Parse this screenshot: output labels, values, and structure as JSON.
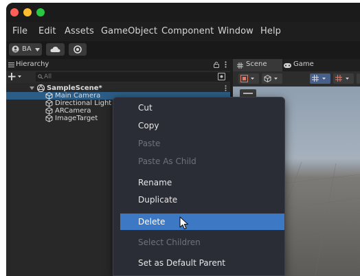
{
  "menubar": {
    "items": [
      "File",
      "Edit",
      "Assets",
      "GameObject",
      "Component",
      "Window",
      "Help"
    ]
  },
  "toolbar": {
    "account_label": "BA"
  },
  "hierarchy": {
    "title": "Hierarchy",
    "search_placeholder": "All",
    "scene_name": "SampleScene*",
    "objects": [
      "Main Camera",
      "Directional Light",
      "ARCamera",
      "ImageTarget"
    ],
    "selected_object": "Main Camera"
  },
  "scene_panel": {
    "tabs": [
      "Scene",
      "Game"
    ],
    "active_tab": "Scene"
  },
  "context_menu": {
    "items": [
      {
        "label": "Cut",
        "enabled": true
      },
      {
        "label": "Copy",
        "enabled": true
      },
      {
        "label": "Paste",
        "enabled": false
      },
      {
        "label": "Paste As Child",
        "enabled": false
      },
      {
        "label": "Rename",
        "enabled": true
      },
      {
        "label": "Duplicate",
        "enabled": true
      },
      {
        "label": "Delete",
        "enabled": true,
        "highlighted": true
      },
      {
        "label": "Select Children",
        "enabled": false
      },
      {
        "label": "Set as Default Parent",
        "enabled": true
      }
    ]
  },
  "colors": {
    "selection": "#2c5d87",
    "menu_highlight": "#3d78c4",
    "menu_background": "#2a2d36"
  }
}
